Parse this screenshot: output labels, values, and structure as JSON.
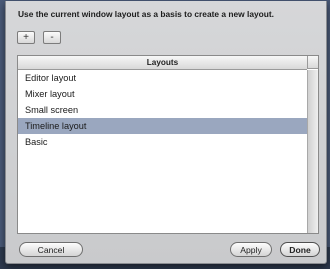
{
  "sheet": {
    "instruction": "Use the current window layout as a basis to create a new layout."
  },
  "toolbar": {
    "add_label": "+",
    "remove_label": "-"
  },
  "layouts_table": {
    "header": "Layouts",
    "rows": [
      "Editor layout",
      "Mixer layout",
      "Small screen",
      "Timeline layout",
      "Basic"
    ],
    "selected_index": 3
  },
  "buttons": {
    "cancel": "Cancel",
    "apply": "Apply",
    "done": "Done"
  }
}
